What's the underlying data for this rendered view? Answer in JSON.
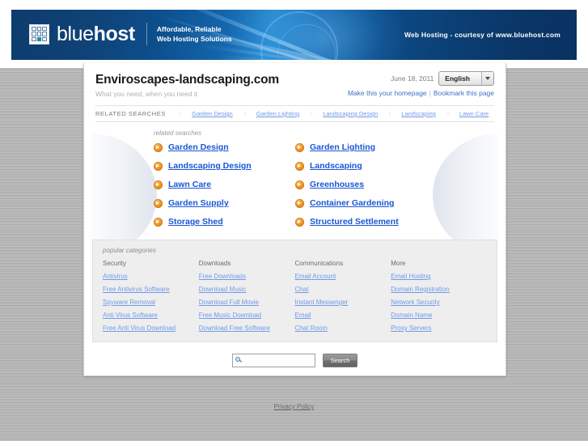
{
  "banner": {
    "brand_light": "blue",
    "brand_bold": "host",
    "tagline_line1": "Affordable, Reliable",
    "tagline_line2": "Web Hosting Solutions",
    "right_text": "Web Hosting - courtesy of www.bluehost.com",
    "accent_color": "#0d4e8c"
  },
  "header": {
    "site_title": "Enviroscapes-landscaping.com",
    "tagline": "What you need, when you need it",
    "date": "June 18, 2011",
    "language": "English",
    "homepage_link": "Make this your homepage",
    "separator": "|",
    "bookmark_link": "Bookmark this page"
  },
  "related_bar": {
    "label": "RELATED SEARCHES",
    "separator": "::",
    "items": [
      "Garden Design",
      "Garden Lighting",
      "Landscaping Design",
      "Landscaping",
      "Lawn Care"
    ]
  },
  "related_searches": {
    "caption": "related searches",
    "links": [
      "Garden Design",
      "Garden Lighting",
      "Landscaping Design",
      "Landscaping",
      "Lawn Care",
      "Greenhouses",
      "Garden Supply",
      "Container Gardening",
      "Storage Shed",
      "Structured Settlement"
    ]
  },
  "popular_categories": {
    "caption": "popular categories",
    "columns": [
      {
        "heading": "Security",
        "links": [
          "Antivirus",
          "Free Antivirus Software",
          "Spyware Removal",
          "Anti Virus Software",
          "Free Anti Virus Download"
        ]
      },
      {
        "heading": "Downloads",
        "links": [
          "Free Downloads",
          "Download Music",
          "Download Full Movie",
          "Free Music Download",
          "Download Free Software"
        ]
      },
      {
        "heading": "Communications",
        "links": [
          "Email Account",
          "Chat",
          "Instant Messenger",
          "Email",
          "Chat Room"
        ]
      },
      {
        "heading": "More",
        "links": [
          "Email Hosting",
          "Domain Registration",
          "Network Security",
          "Domain Name",
          "Proxy Servers"
        ]
      }
    ]
  },
  "search": {
    "value": "",
    "placeholder": "",
    "button_label": "Search"
  },
  "footer": {
    "privacy_policy": "Privacy Policy"
  }
}
